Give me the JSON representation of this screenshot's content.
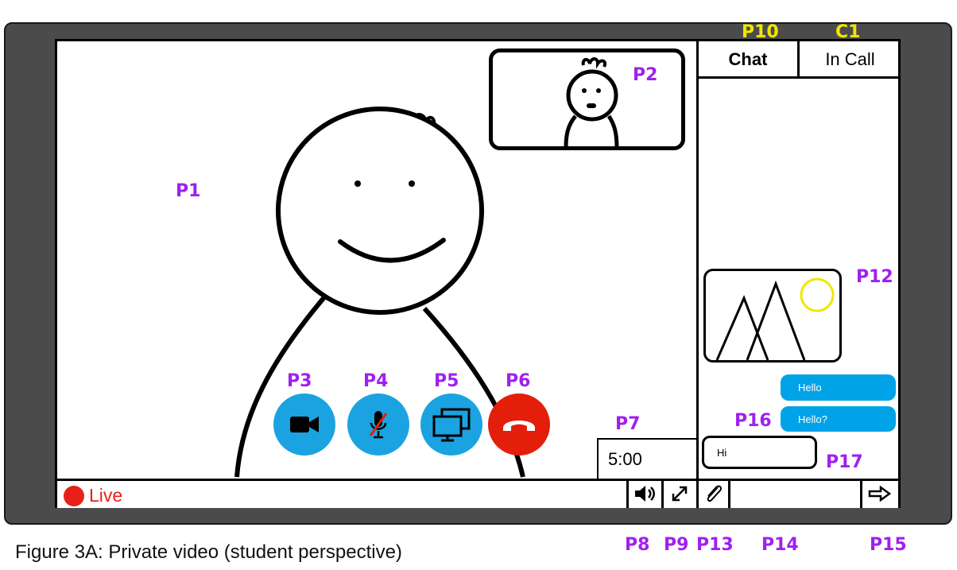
{
  "tags": {
    "p1": "P1",
    "p2": "P2",
    "p3": "P3",
    "p4": "P4",
    "p5": "P5",
    "p6": "P6",
    "p7": "P7",
    "p8": "P8",
    "p9": "P9",
    "p10": "P10",
    "c1": "C1",
    "p12": "P12",
    "p13": "P13",
    "p14": "P14",
    "p15": "P15",
    "p16": "P16",
    "p17": "P17"
  },
  "tabs": {
    "chat": "Chat",
    "in_call": "In Call"
  },
  "timer": "5:00",
  "live_label": "Live",
  "messages": {
    "hello": "Hello",
    "hello2": "Hello?",
    "hi": "Hi"
  },
  "caption": "Figure 3A: Private video (student perspective)",
  "icons": {
    "camera": "video-camera-icon",
    "mic": "microphone-muted-icon",
    "screen": "screen-share-icon",
    "hangup": "hang-up-icon",
    "speaker": "speaker-icon",
    "fullscreen": "fullscreen-icon",
    "attach": "paperclip-icon",
    "send": "send-arrow-icon",
    "live_dot": "live-dot-icon"
  },
  "colors": {
    "button_blue": "#1aa3e0",
    "hangup_red": "#e31e0b",
    "label_purple": "#a020f0",
    "label_yellow": "#f2e600",
    "bubble_blue": "#00a2e8",
    "live_red": "#e8201a"
  }
}
